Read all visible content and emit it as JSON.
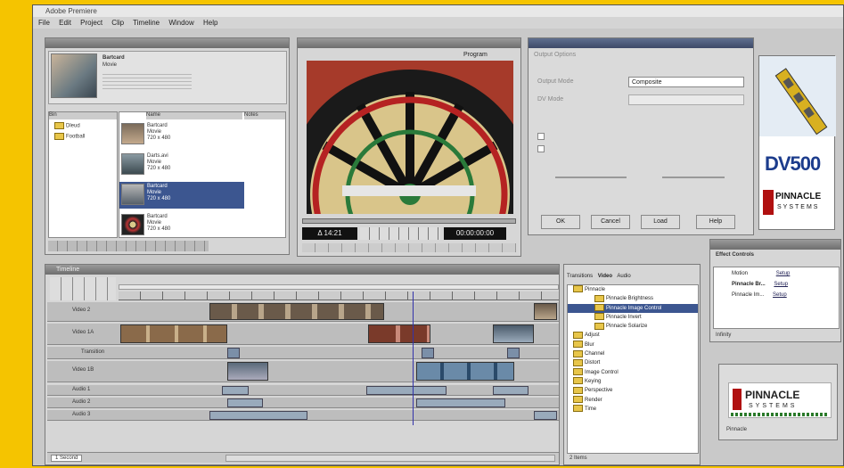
{
  "app": {
    "title": "Adobe Premiere"
  },
  "menu": [
    "File",
    "Edit",
    "Project",
    "Clip",
    "Timeline",
    "Window",
    "Help"
  ],
  "colors": {
    "frame": "#f5c400",
    "pinnacle_red": "#b01010",
    "dv_blue": "#1c3c8c",
    "selection": "#3c5690"
  },
  "project": {
    "header_clip": "Bartcard",
    "header_type": "Movie",
    "bins": [
      "Dleud",
      "Football"
    ],
    "columns": [
      "Bin",
      "Name",
      "Notes"
    ],
    "clips": [
      {
        "name": "Bartcard",
        "type": "Movie",
        "res": "720 x 480"
      },
      {
        "name": "Darts.avi",
        "type": "Movie",
        "res": "720 x 480"
      },
      {
        "name": "Bartcard",
        "type": "Movie",
        "res": "720 x 480"
      },
      {
        "name": "Bartcard",
        "type": "Movie",
        "res": "720 x 480"
      }
    ]
  },
  "monitor": {
    "label": "Program",
    "timecode_left": "Δ 14:21",
    "timecode_right": "00:00:00:00"
  },
  "dialog": {
    "tab": "Output Options",
    "label_output": "Output Mode",
    "label_mode": "DV Mode",
    "select_value": "Composite",
    "buttons": [
      "OK",
      "Cancel",
      "Load",
      "Help"
    ]
  },
  "dv500": {
    "product": "DV500",
    "brand": "PINNACLE",
    "brand2": "SYSTEMS"
  },
  "timeline": {
    "title": "Timeline",
    "tracks": [
      "Video 2",
      "Video 1A",
      "Transition",
      "Video 1B",
      "Audio 1",
      "Audio 2",
      "Audio 3"
    ],
    "zoom": "1 Second"
  },
  "transitions": {
    "tabs": [
      "Transitions",
      "Video",
      "Audio"
    ],
    "items": [
      "Pinnacle",
      "Pinnacle Brightness",
      "Pinnacle Image Control",
      "Pinnacle Invert",
      "Pinnacle Solarize",
      "Adjust",
      "Blur",
      "Channel",
      "Distort",
      "Image Control",
      "Keying",
      "Perspective",
      "Render",
      "Time"
    ],
    "footer": "2 Items"
  },
  "effects": {
    "title": "Effect Controls",
    "rows": [
      "Motion",
      "Pinnacle Br...",
      "Pinnacle Im..."
    ],
    "setup": "Setup",
    "footer": "Infinity"
  },
  "badge": {
    "brand": "PINNACLE",
    "brand2": "SYSTEMS",
    "sub": "Pinnacle"
  }
}
